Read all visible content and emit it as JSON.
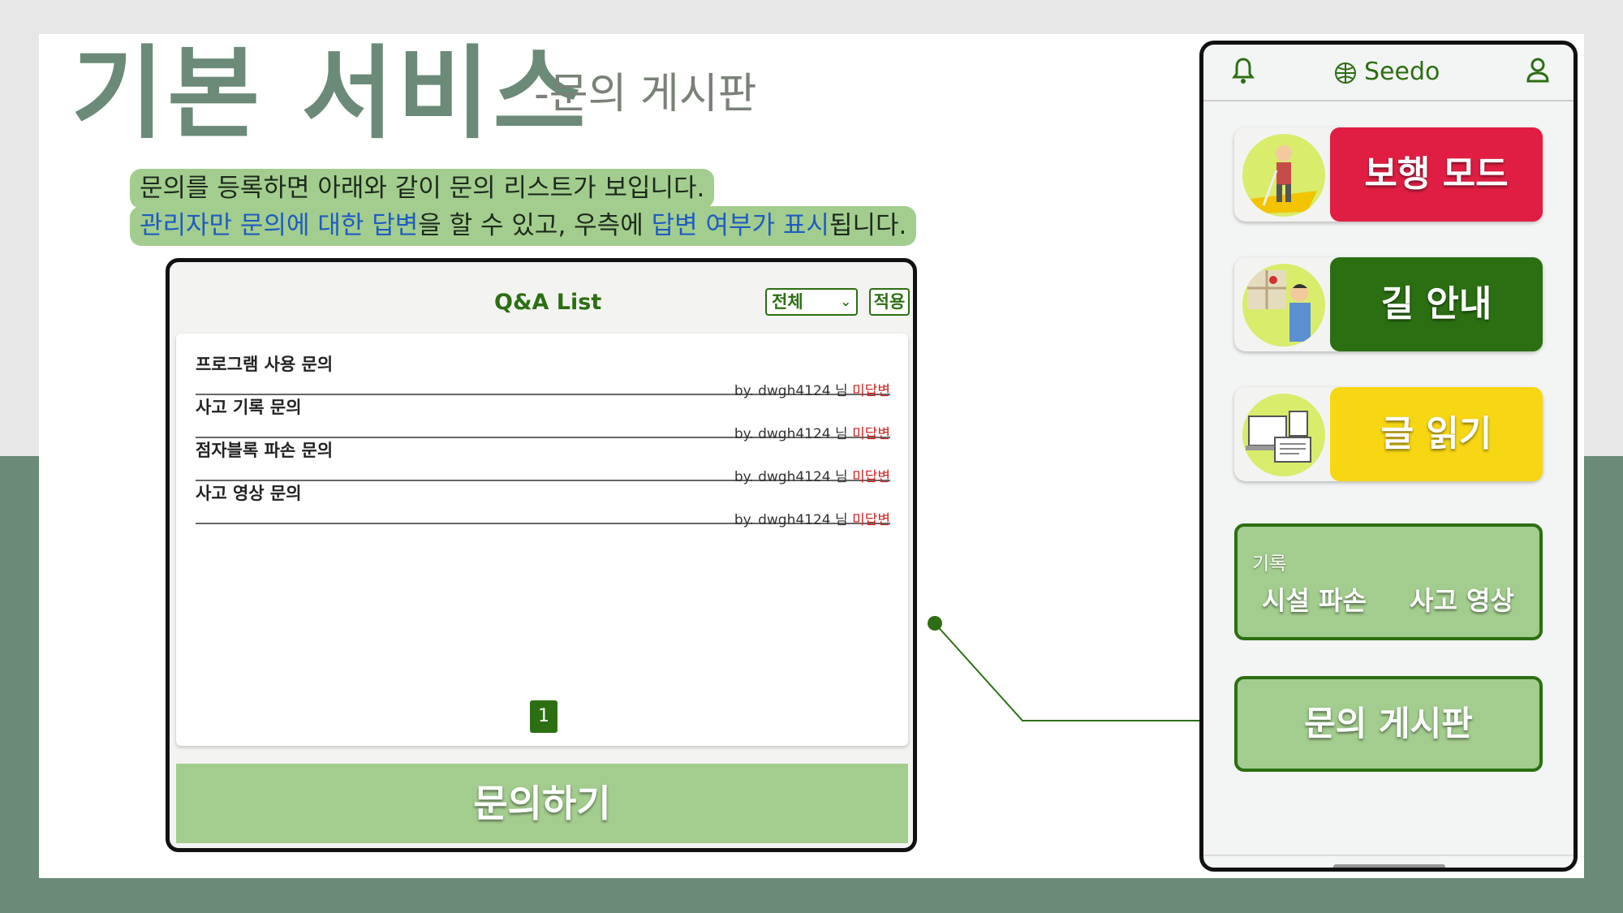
{
  "slide": {
    "title": "기본 서비스",
    "subtitle": "-문의 게시판",
    "note": {
      "line1": "문의를 등록하면 아래와 같이 문의 리스트가 보입니다.",
      "line2": {
        "p1": "관리자만 문의에 대한 답변",
        "p2": "을 할 수 있고, 우측에 ",
        "p3": "답변 여부가 표시",
        "p4": "됩니다."
      }
    }
  },
  "qa": {
    "title": "Q&A List",
    "filter_value": "전체",
    "apply_label": "적용",
    "items": [
      {
        "title": "프로그램 사용 문의",
        "by": "by. dwgh4124 님 ",
        "status": "미답변"
      },
      {
        "title": "사고 기록 문의",
        "by": "by. dwgh4124 님 ",
        "status": "미답변"
      },
      {
        "title": "점자블록 파손 문의",
        "by": "by. dwgh4124 님 ",
        "status": "미답변"
      },
      {
        "title": "사고 영상 문의",
        "by": "by. dwgh4124 님 ",
        "status": "미답변"
      }
    ],
    "page": "1",
    "submit_label": "문의하기"
  },
  "phone": {
    "brand": "Seedo",
    "icons": {
      "left": "bell-icon",
      "brand": "globe-icon",
      "right": "user-icon"
    },
    "modes": [
      {
        "label": "보행 모드",
        "color": "#e01e43"
      },
      {
        "label": "길 안내",
        "color": "#2c6f13"
      },
      {
        "label": "글 읽기",
        "color": "#f7d614"
      }
    ],
    "record": {
      "caption": "기록",
      "item1": "시설 파손",
      "item2": "사고 영상"
    },
    "board_label": "문의 게시판"
  },
  "colors": {
    "accent_green": "#2c6f13",
    "light_green": "#a3cd8e",
    "sage": "#6b8a78",
    "unanswered_red": "#d41f1f",
    "highlight_blue": "#1f5cc2"
  }
}
